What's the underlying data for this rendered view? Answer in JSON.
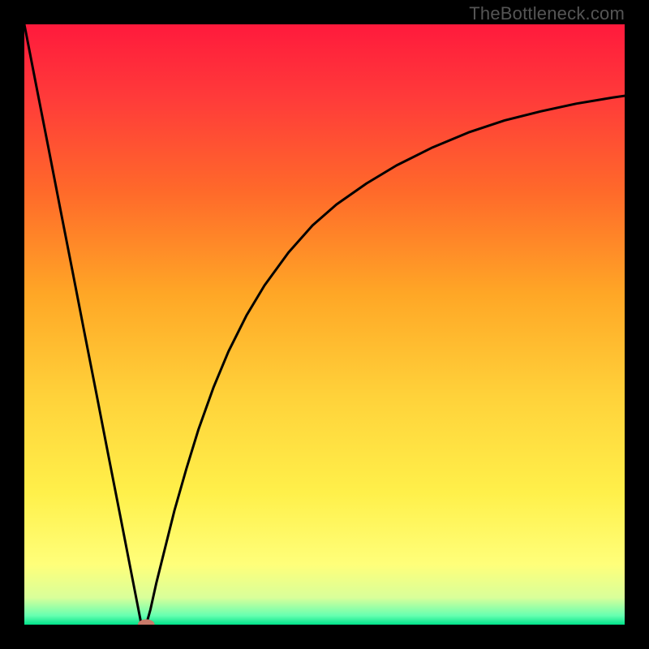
{
  "watermark": "TheBottleneck.com",
  "chart_data": {
    "type": "line",
    "title": "",
    "xlabel": "",
    "ylabel": "",
    "xlim": [
      0,
      100
    ],
    "ylim": [
      0,
      100
    ],
    "background_gradient": {
      "stops": [
        {
          "pos": 0.0,
          "color": "#ff1a3c"
        },
        {
          "pos": 0.12,
          "color": "#ff3a3a"
        },
        {
          "pos": 0.28,
          "color": "#ff6a2a"
        },
        {
          "pos": 0.45,
          "color": "#ffa726"
        },
        {
          "pos": 0.62,
          "color": "#ffd23a"
        },
        {
          "pos": 0.78,
          "color": "#fff04a"
        },
        {
          "pos": 0.9,
          "color": "#ffff7a"
        },
        {
          "pos": 0.955,
          "color": "#d9ff9a"
        },
        {
          "pos": 0.985,
          "color": "#66ffb0"
        },
        {
          "pos": 1.0,
          "color": "#00e28a"
        }
      ]
    },
    "series": [
      {
        "name": "bottleneck-curve",
        "description": "V-shaped curve: steep linear descent from top-left to a minimum near x≈20, then asymptotic rise toward upper right",
        "x": [
          0.0,
          2.0,
          4.0,
          6.0,
          8.0,
          10.0,
          12.0,
          14.0,
          16.0,
          18.0,
          19.5,
          20.3,
          21.0,
          22.0,
          23.5,
          25.0,
          27.0,
          29.0,
          31.5,
          34.0,
          37.0,
          40.0,
          44.0,
          48.0,
          52.0,
          57.0,
          62.0,
          68.0,
          74.0,
          80.0,
          86.0,
          92.0,
          98.0,
          100.0
        ],
        "y": [
          100.0,
          89.7,
          79.5,
          69.2,
          59.0,
          48.7,
          38.5,
          28.2,
          18.0,
          7.7,
          0.0,
          0.0,
          2.5,
          7.0,
          13.0,
          19.0,
          26.0,
          32.5,
          39.5,
          45.5,
          51.5,
          56.5,
          62.0,
          66.5,
          70.0,
          73.5,
          76.5,
          79.5,
          82.0,
          84.0,
          85.5,
          86.8,
          87.8,
          88.1
        ]
      }
    ],
    "marker": {
      "name": "min-marker",
      "x": 20.3,
      "y": 0.0,
      "color": "#c97a6a",
      "rx": 1.4,
      "ry": 0.9
    }
  }
}
